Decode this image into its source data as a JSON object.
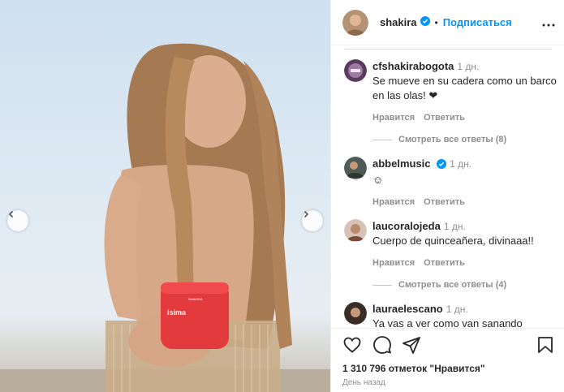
{
  "post": {
    "carousel_prev": "chevron-left",
    "carousel_next": "chevron-right",
    "product_label": "isima",
    "product_small_label": "SHAKIRA"
  },
  "header": {
    "username": "shakira",
    "separator": "•",
    "follow_label": "Подписаться"
  },
  "comments": [
    {
      "user": "cfshakirabogota",
      "time": "1 дн.",
      "text": "Se mueve en su cadera como un barco en las olas! ❤",
      "like": "Нравится",
      "reply": "Ответить"
    },
    {
      "user": "abbelmusic",
      "verified": true,
      "time": "1 дн.",
      "text": "☺",
      "like": "Нравится",
      "reply": "Ответить"
    },
    {
      "user": "laucoralojeda",
      "time": "1 дн.",
      "text": "Cuerpo de quinceañera, divinaaa!!",
      "like": "Нравится",
      "reply": "Ответить"
    },
    {
      "user": "lauraelescano",
      "time": "1 дн.",
      "text": "Ya vas a ver como van sanando"
    }
  ],
  "view_replies": [
    "Смотреть все ответы (8)",
    "Смотреть все ответы (4)"
  ],
  "footer": {
    "likes": "1 310 796 отметок \"Нравится\"",
    "posted": "День назад"
  },
  "colors": {
    "accent": "#0095f6",
    "muted": "#8e8e8e",
    "product": "#e33a3e"
  }
}
